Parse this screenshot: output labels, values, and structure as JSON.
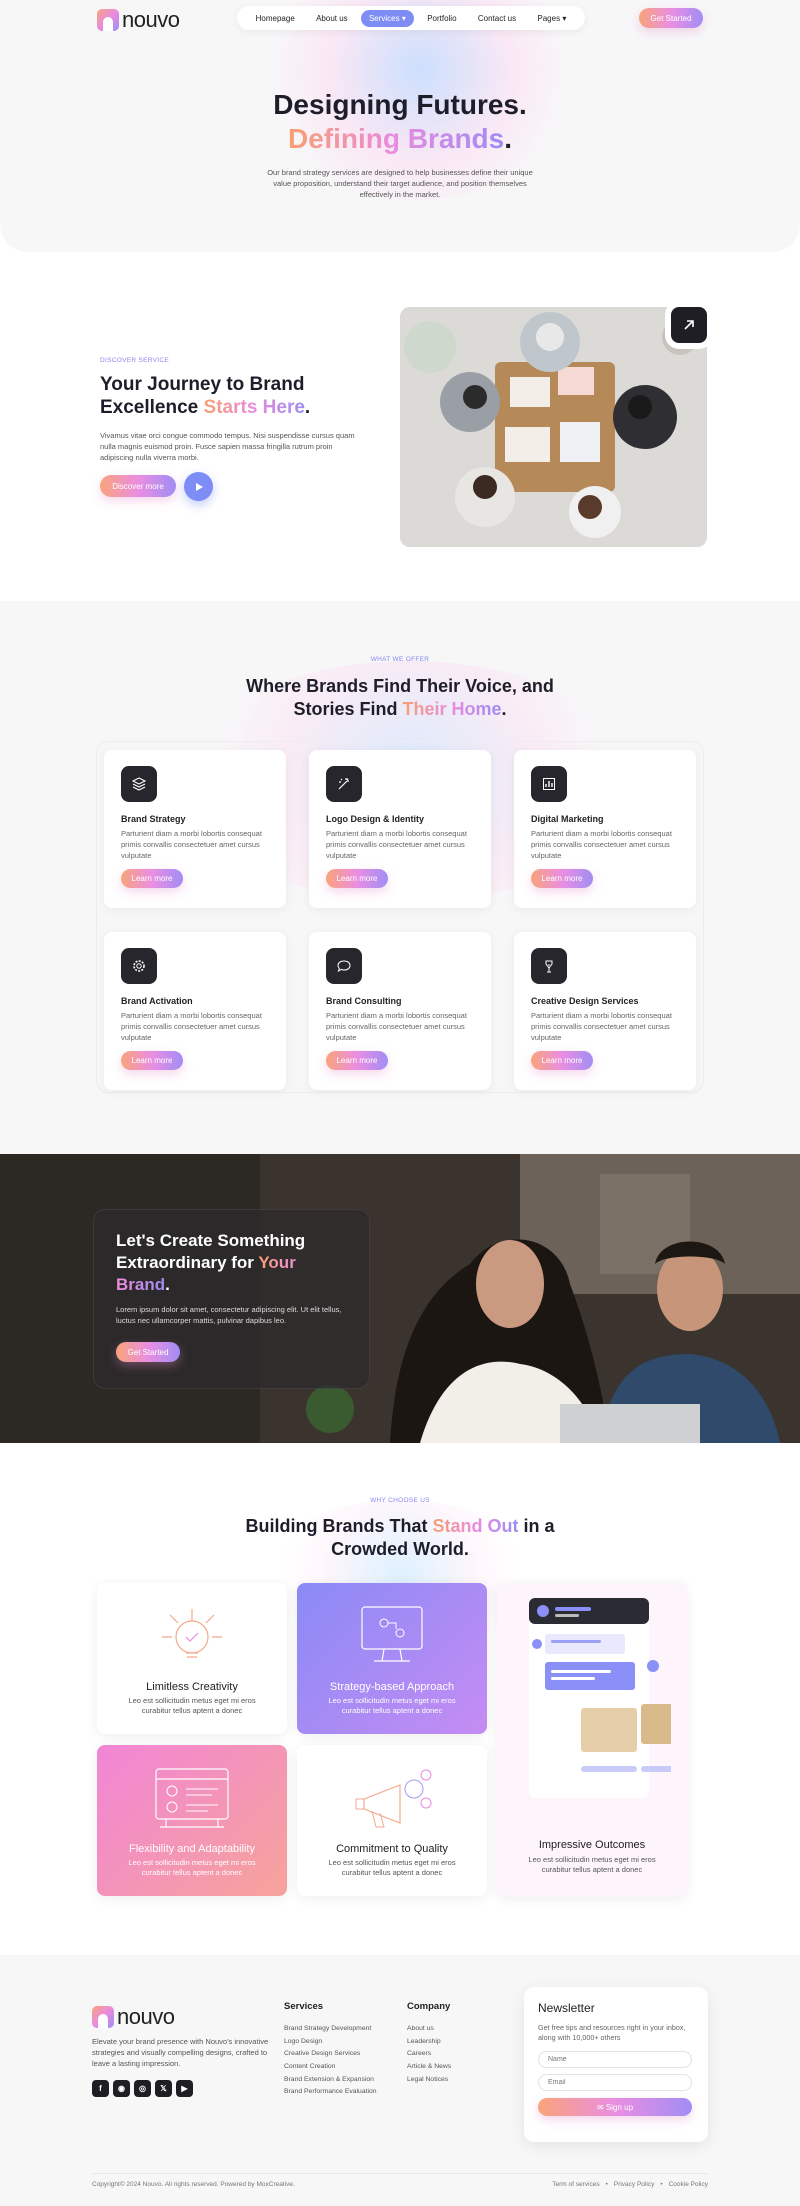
{
  "brand": {
    "logo_text": "nouvo"
  },
  "nav": {
    "items": [
      {
        "label": "Homepage"
      },
      {
        "label": "About us"
      },
      {
        "label": "Services"
      },
      {
        "label": "Portfolio"
      },
      {
        "label": "Contact us"
      },
      {
        "label": "Pages"
      }
    ],
    "cta": "Get Started"
  },
  "hero": {
    "title_line1": "Designing Futures.",
    "title_line2_grad": "Defining Brands",
    "title_line2_end": ".",
    "description": "Our brand strategy services are designed to help businesses define their unique value proposition, understand their target audience, and position themselves effectively in the market."
  },
  "journey": {
    "eyebrow": "DISCOVER SERVICE",
    "title_plain": "Your Journey to Brand Excellence ",
    "title_grad": "Starts Here",
    "title_end": ".",
    "description": "Vivamus vitae orci congue commodo tempus. Nisi suspendisse cursus quam nulla magnis euismod proin. Fusce sapien massa fringilla rutrum proin adipiscing nulla viverra morbi.",
    "button": "Discover more"
  },
  "services": {
    "eyebrow": "WHAT WE OFFER",
    "title_plain": "Where Brands Find Their Voice, and Stories Find ",
    "title_grad": "Their Home",
    "title_end": ".",
    "cards": [
      {
        "title": "Brand Strategy",
        "description": "Parturient diam a morbi lobortis consequat primis convallis consectetuer amet cursus vulputate",
        "button": "Learn more",
        "icon": "layers-icon"
      },
      {
        "title": "Logo Design & Identity",
        "description": "Parturient diam a morbi lobortis consequat primis convallis consectetuer amet cursus vulputate",
        "button": "Learn more",
        "icon": "magic-wand-icon"
      },
      {
        "title": "Digital Marketing",
        "description": "Parturient diam a morbi lobortis consequat primis convallis consectetuer amet cursus vulputate",
        "button": "Learn more",
        "icon": "bar-chart-icon"
      },
      {
        "title": "Brand Activation",
        "description": "Parturient diam a morbi lobortis consequat primis convallis consectetuer amet cursus vulputate",
        "button": "Learn more",
        "icon": "gear-icon"
      },
      {
        "title": "Brand Consulting",
        "description": "Parturient diam a morbi lobortis consequat primis convallis consectetuer amet cursus vulputate",
        "button": "Learn more",
        "icon": "chat-bubble-icon"
      },
      {
        "title": "Creative Design Services",
        "description": "Parturient diam a morbi lobortis consequat primis convallis consectetuer amet cursus vulputate",
        "button": "Learn more",
        "icon": "pen-tool-icon"
      }
    ]
  },
  "cta": {
    "title_plain": "Let's Create Something Extraordinary for ",
    "title_grad": "Your Brand",
    "title_end": ".",
    "description": "Lorem ipsum dolor sit amet, consectetur adipiscing elit. Ut elit tellus, luctus nec ullamcorper mattis, pulvinar dapibus leo.",
    "button": "Get Started"
  },
  "why": {
    "eyebrow": "WHY CHOOSE US",
    "title_plain1": "Building Brands That ",
    "title_grad": "Stand Out",
    "title_plain2": " in a Crowded World.",
    "cards": [
      {
        "title": "Limitless Creativity",
        "description": "Leo est sollicitudin metus eget mi eros curabitur tellus aptent a donec",
        "icon": "lightbulb-icon"
      },
      {
        "title": "Strategy-based Approach",
        "description": "Leo est sollicitudin metus eget mi eros curabitur tellus aptent a donec",
        "icon": "monitor-icon"
      },
      {
        "title": "Impressive Outcomes",
        "description": "Leo est sollicitudin metus eget mi eros curabitur tellus aptent a donec",
        "icon": "mockup-icon"
      },
      {
        "title": "Flexibility and Adaptability",
        "description": "Leo est sollicitudin metus eget mi eros curabitur tellus aptent a donec",
        "icon": "layout-icon"
      },
      {
        "title": "Commitment to Quality",
        "description": "Leo est sollicitudin metus eget mi eros curabitur tellus aptent a donec",
        "icon": "megaphone-icon"
      }
    ]
  },
  "footer": {
    "description": "Elevate your brand presence with Nouvo's innovative strategies and visually compelling designs, crafted to leave a lasting impression.",
    "socials": [
      "facebook-icon",
      "instagram-icon",
      "dribbble-icon",
      "x-icon",
      "youtube-icon"
    ],
    "services_heading": "Services",
    "services_links": [
      "Brand Strategy Development",
      "Logo Design",
      "Creative Design Services",
      "Content Creation",
      "Brand Extension & Expansion",
      "Brand Performance Evaluation"
    ],
    "company_heading": "Company",
    "company_links": [
      "About us",
      "Leadership",
      "Careers",
      "Article & News",
      "Legal Notices"
    ],
    "newsletter": {
      "title": "Newsletter",
      "description": "Get free tips and resources right in your inbox, along with 10,000+ others",
      "name_placeholder": "Name",
      "email_placeholder": "Email",
      "button": "Sign up"
    },
    "copyright": "Copyright© 2024 Nouvo. All rights reserved. Powered by MoxCreative.",
    "legal": [
      "Term of services",
      "Privacy Policy",
      "Cookie Policy"
    ]
  }
}
